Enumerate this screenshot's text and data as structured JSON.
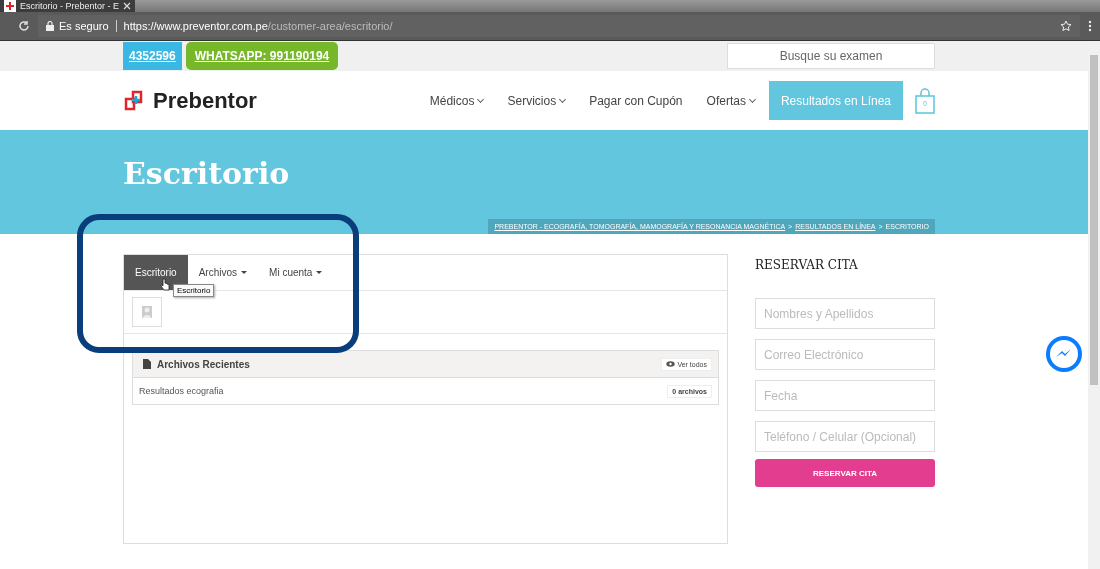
{
  "browser": {
    "tab_title": "Escritorio - Prebentor - E",
    "security": "Es seguro",
    "url_host": "https://www.preventor.com.pe",
    "url_path": "/customer-area/escritorio/"
  },
  "topbar": {
    "phone": "4352596",
    "whatsapp": "WHATSAPP: 991190194",
    "search": {
      "placeholder": "Busque su examen"
    }
  },
  "header": {
    "logo": "Prebentor",
    "nav": [
      {
        "label": "Médicos",
        "dropdown": true
      },
      {
        "label": "Servicios",
        "dropdown": true
      },
      {
        "label": "Pagar con Cupón",
        "dropdown": false
      },
      {
        "label": "Ofertas",
        "dropdown": true
      }
    ],
    "cta": "Resultados en Línea",
    "cart_count": "0"
  },
  "hero": {
    "title": "Escritorio",
    "breadcrumb": [
      {
        "kind": "link",
        "text": "PREBENTOR - ECOGRAFÍA, TOMOGRAFÍA, MAMOGRAFÍA Y RESONANCIA MAGNÉTICA"
      },
      {
        "kind": "separator",
        "text": ">"
      },
      {
        "kind": "link",
        "text": "RESULTADOS EN LÍNEA"
      },
      {
        "kind": "separator",
        "text": ">"
      },
      {
        "kind": "current",
        "text": "ESCRITORIO"
      }
    ]
  },
  "panel": {
    "tabs": [
      {
        "label": "Escritorio",
        "selected": true,
        "dropdown": false
      },
      {
        "label": "Archivos",
        "selected": false,
        "dropdown": true
      },
      {
        "label": "Mi cuenta",
        "selected": false,
        "dropdown": true
      }
    ],
    "tooltip": "Escritorio",
    "recent": {
      "title": "Archivos Recientes",
      "view_all": "Ver todos",
      "rows": [
        {
          "name": "Resultados ecografia",
          "count": "0 archivos"
        }
      ]
    }
  },
  "booking": {
    "title": "RESERVAR CITA",
    "fields": [
      {
        "placeholder": "Nombres y Apellidos"
      },
      {
        "placeholder": "Correo Electrónico"
      },
      {
        "placeholder": "Fecha"
      },
      {
        "placeholder": "Teléfono / Celular (Opcional)"
      }
    ],
    "button": "RESERVAR CITA"
  }
}
